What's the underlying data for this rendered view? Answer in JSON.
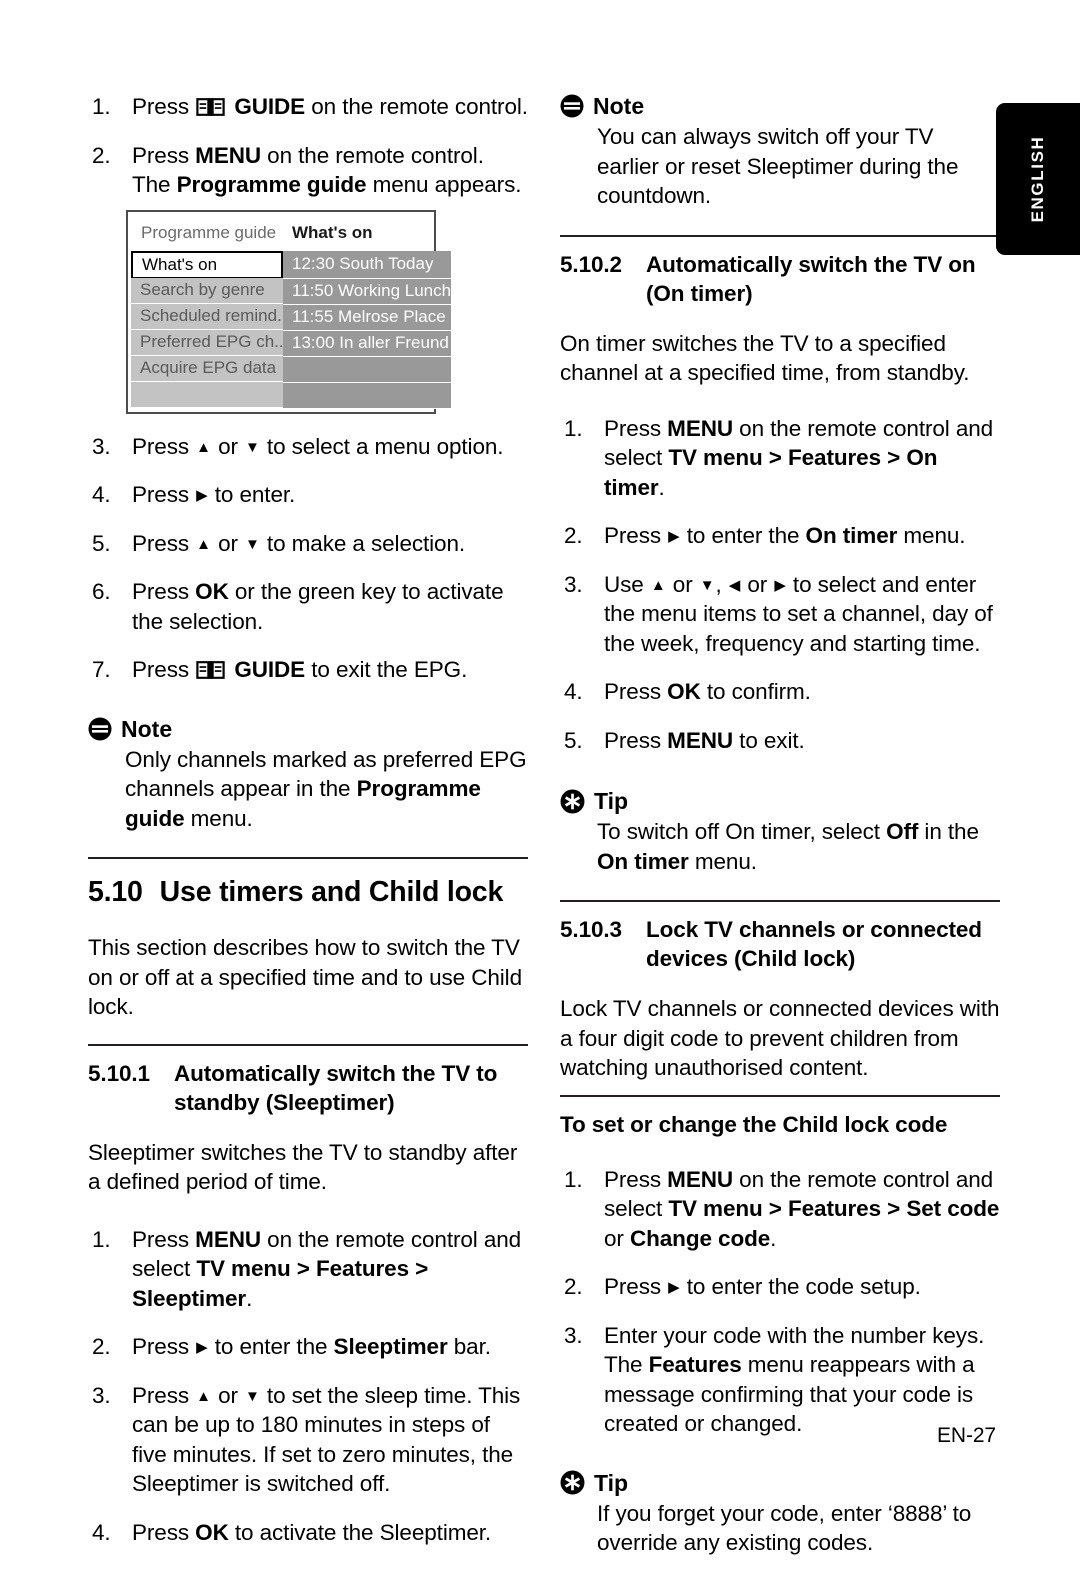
{
  "page": {
    "footer_label": "EN-27",
    "language_tab": "ENGLISH"
  },
  "left_column": {
    "epg_steps_top": [
      {
        "num": "1.",
        "html": "Press <span class=\"icon-book-slot\"></span> <b>GUIDE</b> on the remote control."
      },
      {
        "num": "2.",
        "html": "Press <b>MENU</b> on the remote control. The <b>Programme guide</b> menu appears."
      }
    ],
    "tv_screenshot": {
      "title_left": "Programme guide",
      "title_right": "What's on",
      "menu_items": [
        {
          "label": "What's on",
          "selected": true
        },
        {
          "label": "Search by genre",
          "selected": false
        },
        {
          "label": "Scheduled remind...",
          "selected": false
        },
        {
          "label": "Preferred EPG ch...",
          "selected": false
        },
        {
          "label": "Acquire EPG data",
          "selected": false
        },
        {
          "label": "",
          "selected": false
        }
      ],
      "programmes": [
        "12:30 South Today",
        "11:50 Working Lunch",
        "11:55 Melrose Place",
        "13:00 In aller Freund",
        "",
        ""
      ]
    },
    "epg_steps_bottom": [
      {
        "num": "3.",
        "html": "Press <span class=\"arw\">&#9650;</span> or <span class=\"arw\">&#9660;</span> to select a menu option."
      },
      {
        "num": "4.",
        "html": "Press <span class=\"arw\">&#9654;</span> to enter."
      },
      {
        "num": "5.",
        "html": "Press <span class=\"arw\">&#9650;</span> or <span class=\"arw\">&#9660;</span> to make a selection."
      },
      {
        "num": "6.",
        "html": "Press <b>OK</b> or the green key to activate the selection."
      },
      {
        "num": "7.",
        "html": "Press <span class=\"icon-book-slot\"></span> <b>GUIDE</b> to exit the EPG."
      }
    ],
    "note": {
      "title": "Note",
      "icon": "note-icon",
      "body_html": "Only channels marked as preferred EPG channels appear in the <b>Programme guide</b> menu."
    },
    "section_510": {
      "number": "5.10",
      "title": "Use timers and Child lock",
      "intro": "This section describes how to switch the TV on or off at a specified time and to use Child lock."
    },
    "section_5101": {
      "number": "5.10.1",
      "title_line1": "Automatically switch the TV to",
      "title_line2": "standby (Sleeptimer)",
      "intro": "Sleeptimer switches the TV to standby after a defined period of time.",
      "steps": [
        {
          "num": "1.",
          "html": "Press <b>MENU</b> on the remote control and select <b>TV menu &gt; Features &gt; Sleeptimer</b>."
        },
        {
          "num": "2.",
          "html": "Press <span class=\"arw\">&#9654;</span> to enter the <b>Sleeptimer</b> bar."
        },
        {
          "num": "3.",
          "html": "Press <span class=\"arw\">&#9650;</span> or <span class=\"arw\">&#9660;</span> to set the sleep time. This can be up to 180 minutes in steps of five minutes. If set to zero minutes, the Sleeptimer is switched off."
        },
        {
          "num": "4.",
          "html": "Press <b>OK</b> to activate the Sleeptimer."
        }
      ]
    }
  },
  "right_column": {
    "note_top": {
      "title": "Note",
      "icon": "note-icon",
      "body_html": "You can always switch off your TV earlier or reset Sleeptimer during the countdown."
    },
    "section_5102": {
      "number": "5.10.2",
      "title_line1": "Automatically switch the TV on",
      "title_line2": "(On timer)",
      "intro": "On timer switches the TV to a specified channel at a specified time, from standby.",
      "steps": [
        {
          "num": "1.",
          "html": "Press <b>MENU</b> on the remote control and select <b>TV menu &gt; Features &gt; On timer</b>."
        },
        {
          "num": "2.",
          "html": "Press <span class=\"arw\">&#9654;</span> to enter the <b>On timer</b> menu."
        },
        {
          "num": "3.",
          "html": "Use <span class=\"arw\">&#9650;</span> or <span class=\"arw\">&#9660;</span>, <span class=\"arw\">&#9664;</span> or <span class=\"arw\">&#9654;</span> to select and enter the menu items to set a channel, day of the week, frequency and starting time."
        },
        {
          "num": "4.",
          "html": "Press <b>OK</b> to confirm."
        },
        {
          "num": "5.",
          "html": "Press <b>MENU</b> to exit."
        }
      ]
    },
    "tip_on_timer": {
      "title": "Tip",
      "icon": "tip-icon",
      "body_html": "To switch off On timer, select <b>Off</b> in the <b>On timer</b> menu."
    },
    "section_5103": {
      "number": "5.10.3",
      "title_line1": "Lock TV channels or connected",
      "title_line2": "devices (Child lock)",
      "intro": "Lock TV channels or connected devices with a four digit code to prevent children from watching unauthorised content."
    },
    "child_lock_code": {
      "heading": "To set or change the Child lock code",
      "steps": [
        {
          "num": "1.",
          "html": "Press <b>MENU</b> on the remote control and select <b>TV menu &gt; Features &gt; Set code</b> or <b>Change code</b>."
        },
        {
          "num": "2.",
          "html": "Press <span class=\"arw\">&#9654;</span> to enter the code setup."
        },
        {
          "num": "3.",
          "html": "Enter your code with the number keys. The <b>Features</b> menu reappears with a message confirming that your code is created or changed."
        }
      ]
    },
    "tip_forgot_code": {
      "title": "Tip",
      "icon": "tip-icon",
      "body_html": "If you forget your code, enter &lsquo;8888&rsquo; to override any existing codes."
    }
  }
}
